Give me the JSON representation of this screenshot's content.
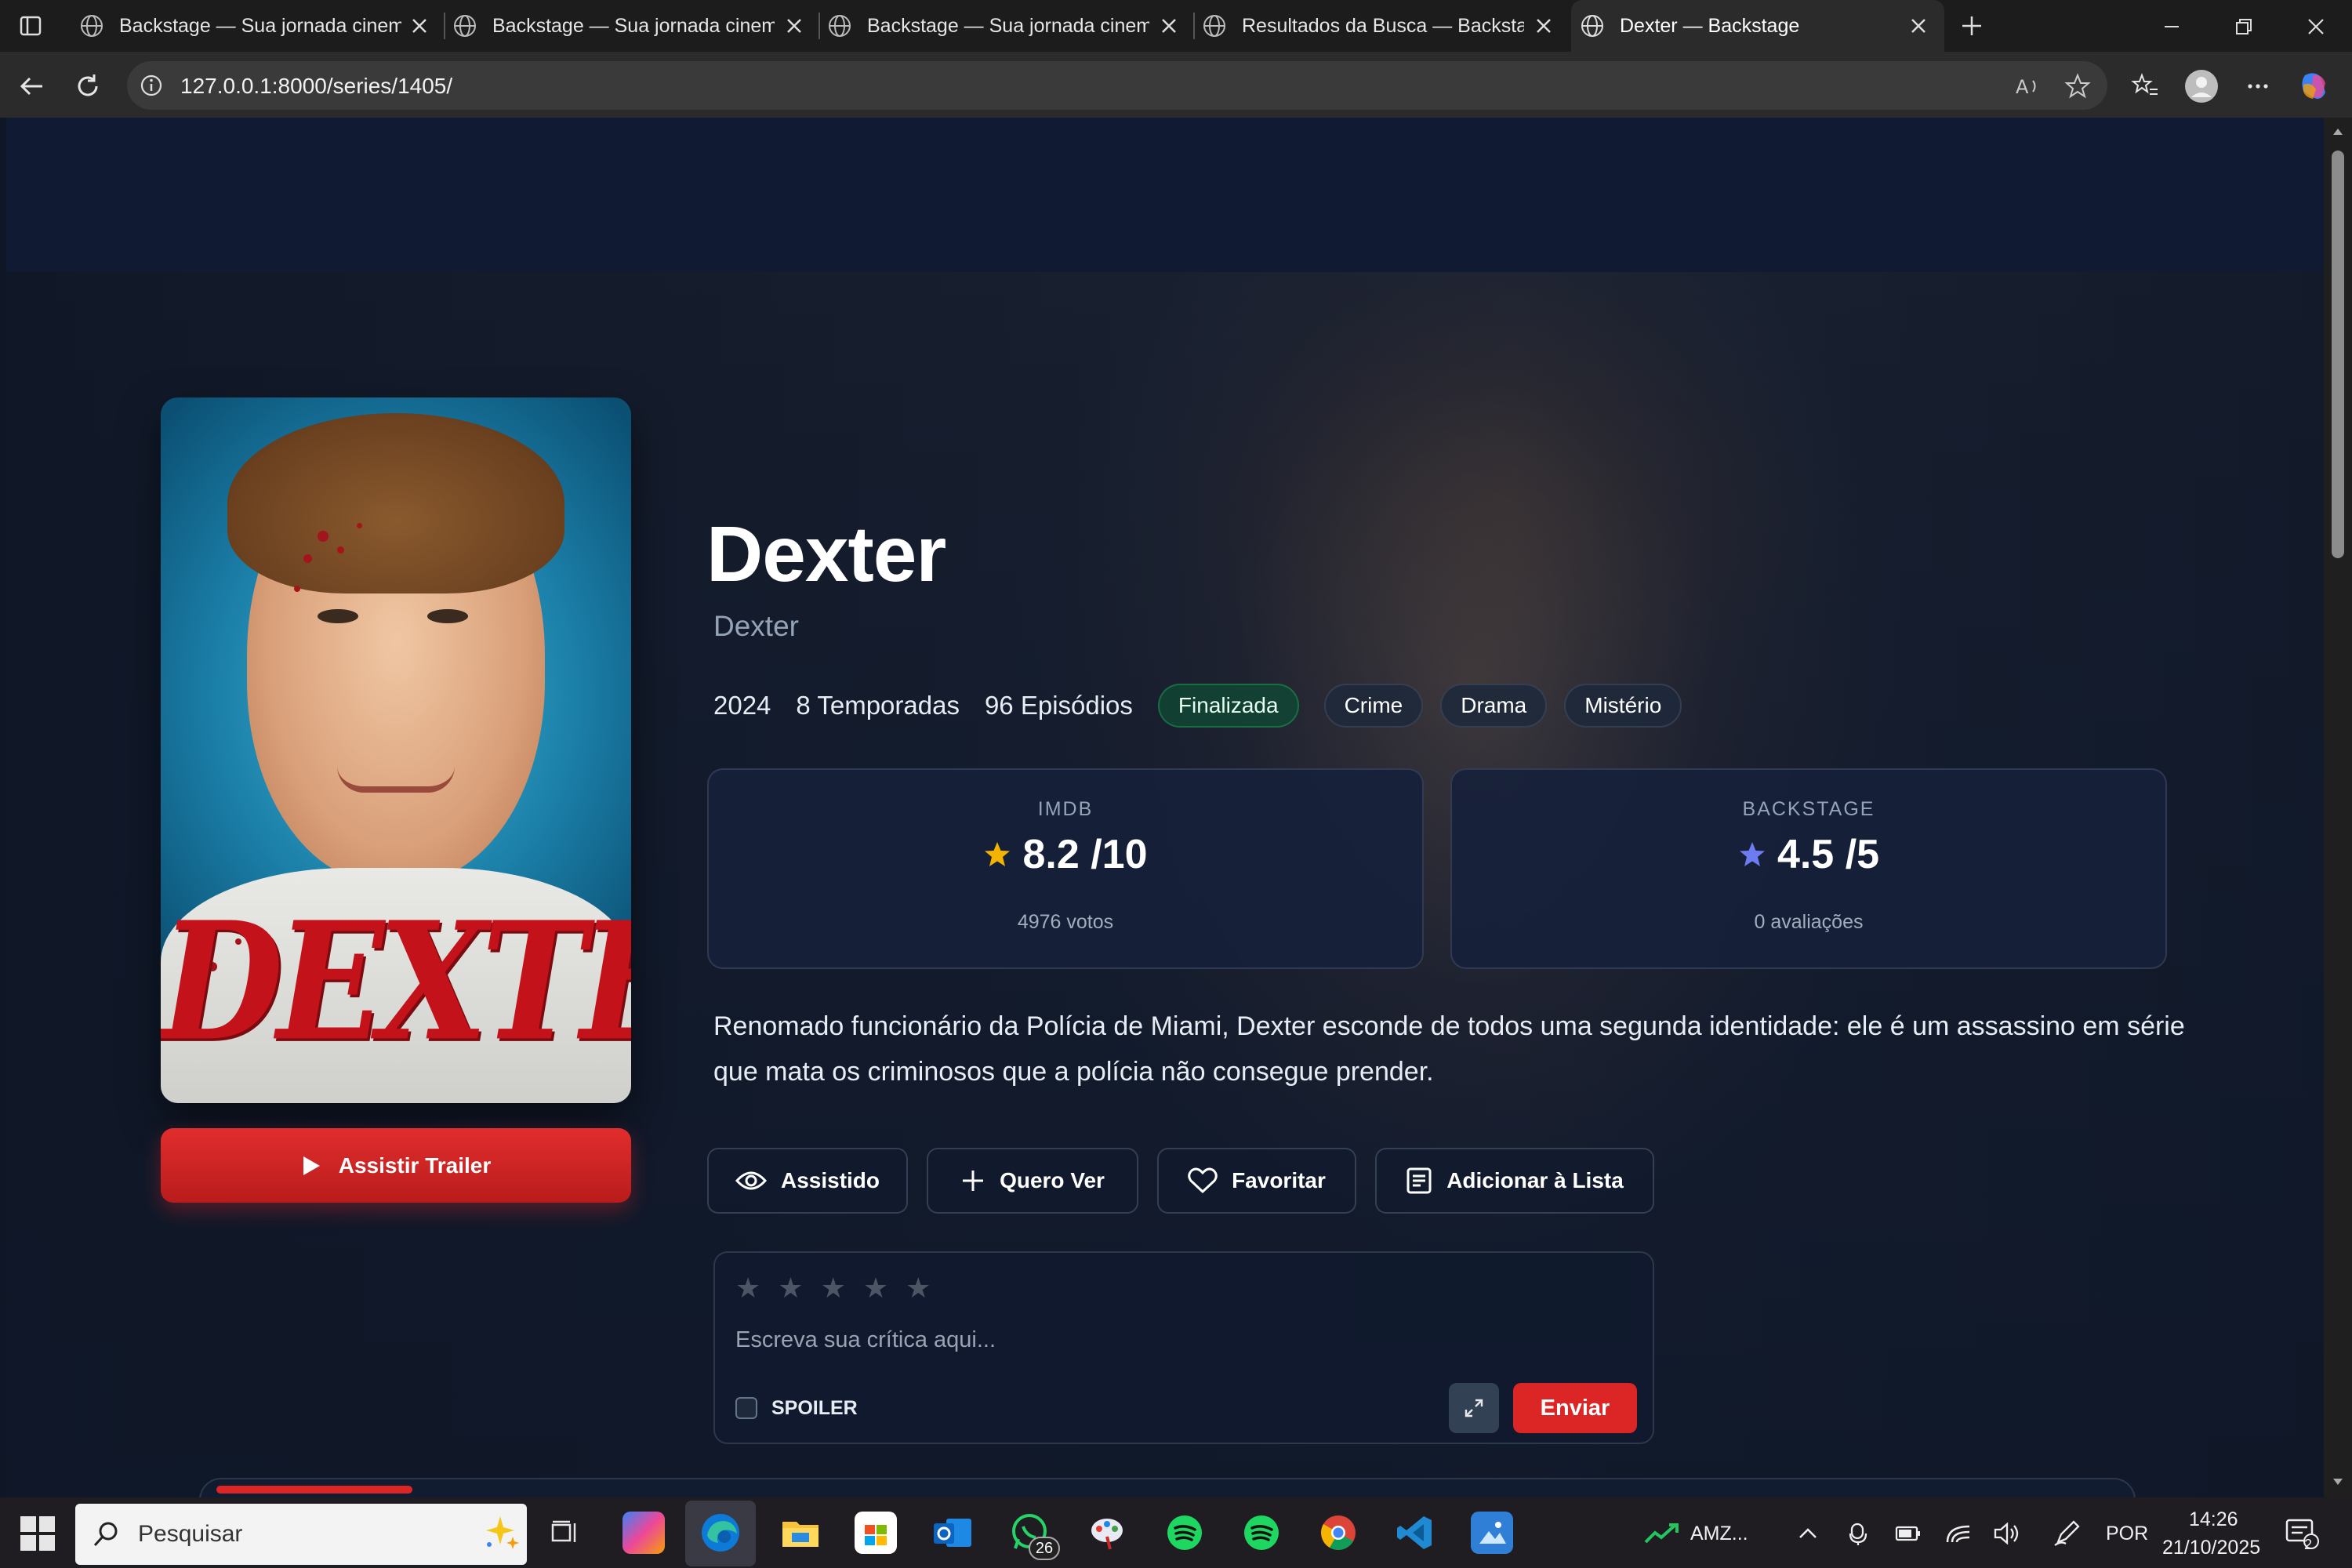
{
  "browser": {
    "tabs": [
      {
        "title": "Backstage — Sua jornada cinematográfica"
      },
      {
        "title": "Backstage — Sua jornada cinematográfica"
      },
      {
        "title": "Backstage — Sua jornada cinematográfica"
      },
      {
        "title": "Resultados da Busca — Backstage"
      },
      {
        "title": "Dexter — Backstage",
        "active": true
      }
    ],
    "url": "127.0.0.1:8000/series/1405/"
  },
  "series": {
    "title": "Dexter",
    "original_title": "Dexter",
    "poster_logo": "DEXTER",
    "year": "2024",
    "seasons": "8 Temporadas",
    "episodes": "96 Episódios",
    "status": "Finalizada",
    "genres": [
      "Crime",
      "Drama",
      "Mistério"
    ],
    "synopsis": "Renomado funcionário da Polícia de Miami, Dexter esconde de todos uma segunda identidade: ele é um assassino em série que mata os criminosos que a polícia não consegue prender."
  },
  "ratings": {
    "imdb": {
      "label": "IMDB",
      "score": "8.2",
      "scale": "/10",
      "sub": "4976 votos",
      "star_color": "#f5b301"
    },
    "backstage": {
      "label": "BACKSTAGE",
      "score": "4.5",
      "scale": "/5",
      "sub": "0 avaliações",
      "star_color": "#6d7cf0"
    }
  },
  "actions": {
    "trailer": "Assistir Trailer",
    "watched": "Assistido",
    "want": "Quero Ver",
    "favorite": "Favoritar",
    "add_list": "Adicionar à Lista"
  },
  "review": {
    "stars": [
      "★",
      "★",
      "★",
      "★",
      "★"
    ],
    "placeholder": "Escreva sua crítica aqui...",
    "spoiler_label": "SPOILER",
    "send_label": "Enviar"
  },
  "taskbar": {
    "search_label": "Pesquisar",
    "whatsapp_badge": "26",
    "stock_label": "AMZ...",
    "language": "POR",
    "time": "14:26",
    "date": "21/10/2025",
    "notification_count": "2"
  },
  "colors": {
    "accent_red": "#dc2626",
    "page_bg": "#0f1727",
    "status_green": "#104634"
  }
}
